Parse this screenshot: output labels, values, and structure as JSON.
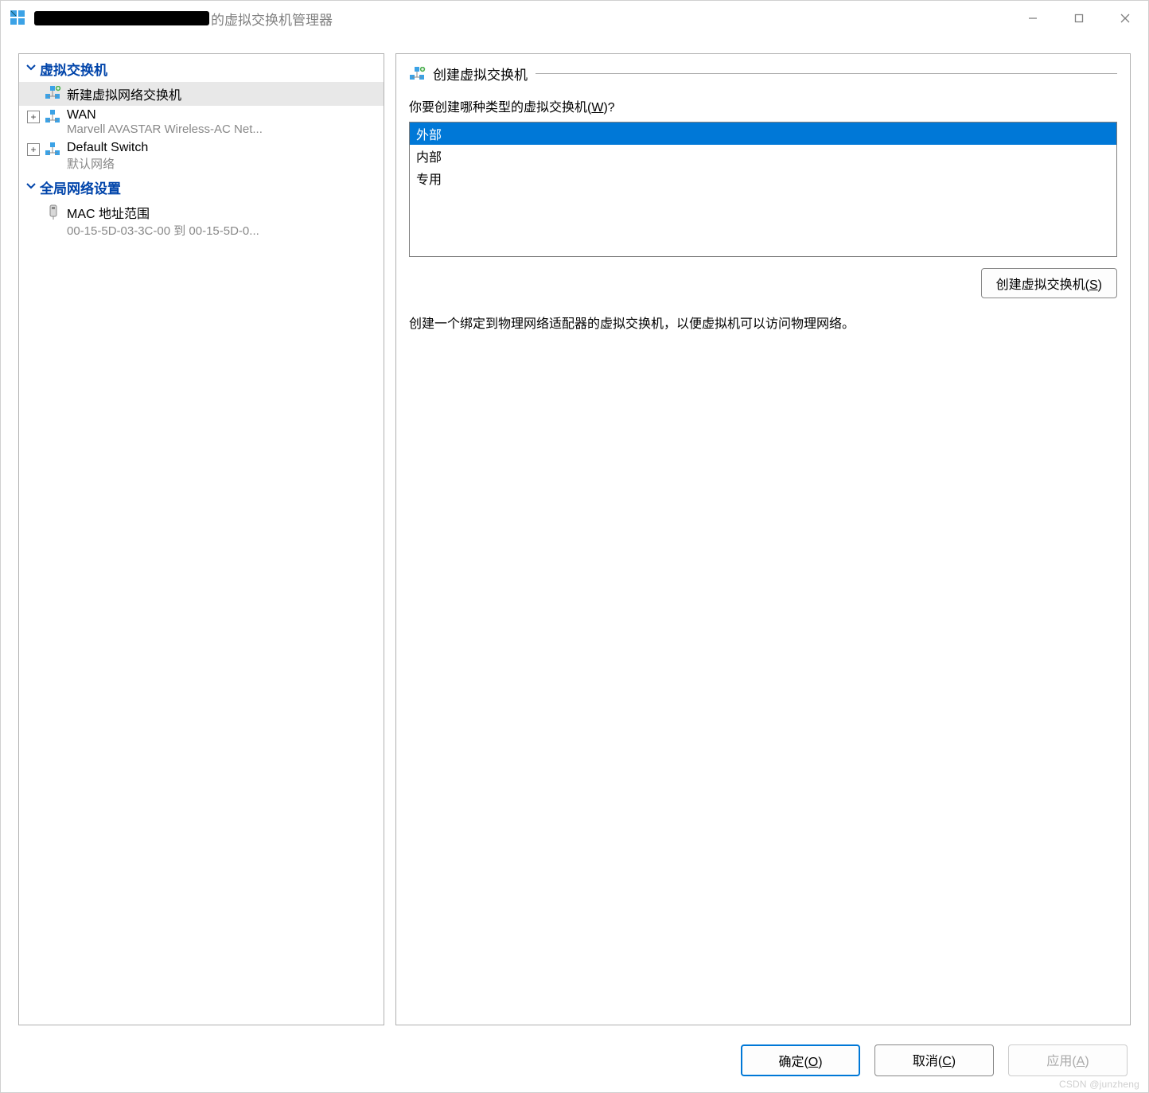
{
  "titlebar": {
    "title_suffix": "的虚拟交换机管理器"
  },
  "sidebar": {
    "section1_label": "虚拟交换机",
    "new_switch_label": "新建虚拟网络交换机",
    "wan_label": "WAN",
    "wan_sub": "Marvell AVASTAR Wireless-AC Net...",
    "default_switch_label": "Default Switch",
    "default_switch_sub": "默认网络",
    "section2_label": "全局网络设置",
    "mac_range_label": "MAC 地址范围",
    "mac_range_sub": "00-15-5D-03-3C-00 到 00-15-5D-0..."
  },
  "main": {
    "group_title": "创建虚拟交换机",
    "prompt_prefix": "你要创建哪种类型的虚拟交换机(",
    "prompt_accel": "W",
    "prompt_suffix": ")?",
    "types": [
      "外部",
      "内部",
      "专用"
    ],
    "create_btn_prefix": "创建虚拟交换机(",
    "create_btn_accel": "S",
    "create_btn_suffix": ")",
    "description": "创建一个绑定到物理网络适配器的虚拟交换机，以便虚拟机可以访问物理网络。"
  },
  "footer": {
    "ok_prefix": "确定(",
    "ok_accel": "O",
    "ok_suffix": ")",
    "cancel_prefix": "取消(",
    "cancel_accel": "C",
    "cancel_suffix": ")",
    "apply_prefix": "应用(",
    "apply_accel": "A",
    "apply_suffix": ")"
  },
  "watermark": "CSDN @junzheng"
}
